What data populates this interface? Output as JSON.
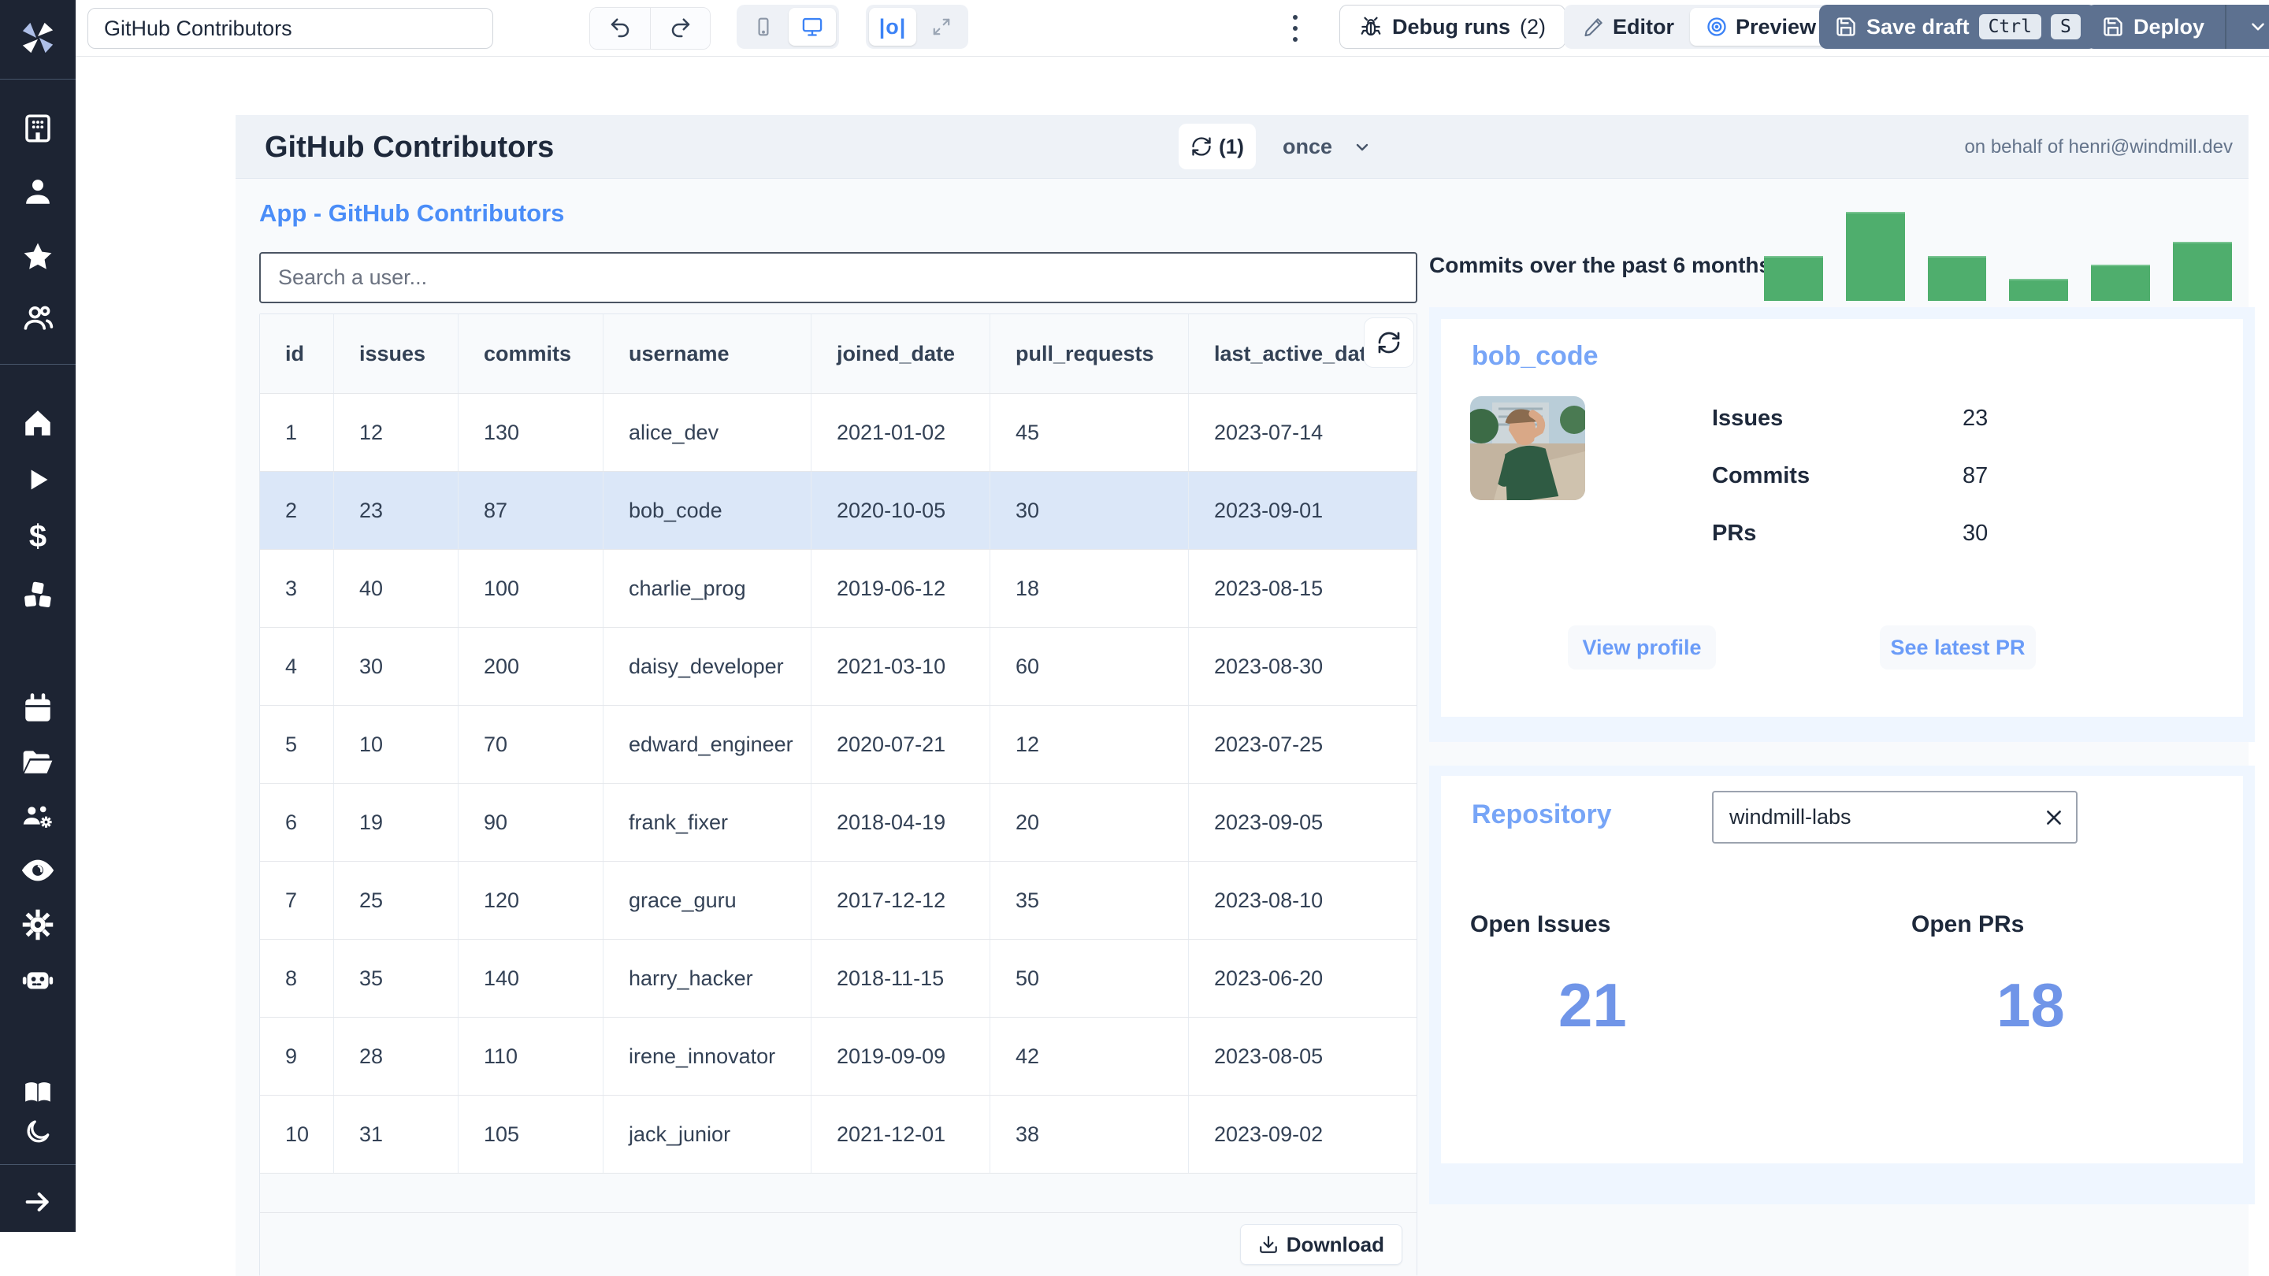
{
  "toolbar": {
    "app_title_input": "GitHub Contributors",
    "debug_runs_label": "Debug runs",
    "debug_runs_count": "(2)",
    "editor_label": "Editor",
    "preview_label": "Preview",
    "save_draft_label": "Save draft",
    "kbd_ctrl": "Ctrl",
    "kbd_s": "S",
    "deploy_label": "Deploy"
  },
  "sidebar": {
    "icons": [
      "windmill-logo",
      "building",
      "user",
      "star",
      "people",
      "home",
      "play",
      "dollar",
      "cubes",
      "calendar",
      "folder",
      "people-gear",
      "eye",
      "gear",
      "robot",
      "book",
      "moon",
      "arrow-right"
    ]
  },
  "header": {
    "title": "GitHub Contributors",
    "refresh_count": "(1)",
    "schedule_label": "once",
    "on_behalf": "on behalf of henri@windmill.dev"
  },
  "main": {
    "app_heading": "App - GitHub Contributors",
    "search_placeholder": "Search a user...",
    "table": {
      "columns": [
        "id",
        "issues",
        "commits",
        "username",
        "joined_date",
        "pull_requests",
        "last_active_date"
      ],
      "rows": [
        [
          "1",
          "12",
          "130",
          "alice_dev",
          "2021-01-02",
          "45",
          "2023-07-14"
        ],
        [
          "2",
          "23",
          "87",
          "bob_code",
          "2020-10-05",
          "30",
          "2023-09-01"
        ],
        [
          "3",
          "40",
          "100",
          "charlie_prog",
          "2019-06-12",
          "18",
          "2023-08-15"
        ],
        [
          "4",
          "30",
          "200",
          "daisy_developer",
          "2021-03-10",
          "60",
          "2023-08-30"
        ],
        [
          "5",
          "10",
          "70",
          "edward_engineer",
          "2020-07-21",
          "12",
          "2023-07-25"
        ],
        [
          "6",
          "19",
          "90",
          "frank_fixer",
          "2018-04-19",
          "20",
          "2023-09-05"
        ],
        [
          "7",
          "25",
          "120",
          "grace_guru",
          "2017-12-12",
          "35",
          "2023-08-10"
        ],
        [
          "8",
          "35",
          "140",
          "harry_hacker",
          "2018-11-15",
          "50",
          "2023-06-20"
        ],
        [
          "9",
          "28",
          "110",
          "irene_innovator",
          "2019-09-09",
          "42",
          "2023-08-05"
        ],
        [
          "10",
          "31",
          "105",
          "jack_junior",
          "2021-12-01",
          "38",
          "2023-09-02"
        ]
      ],
      "selected_row_index": 1,
      "download_label": "Download"
    }
  },
  "right_panel": {
    "chart": {
      "type": "bar",
      "label": "Commits over the past 6 months:",
      "bar_color": "#4fae6d",
      "values_pct": [
        50,
        100,
        50,
        25,
        41,
        66
      ]
    },
    "user_card": {
      "username": "bob_code",
      "stats": [
        {
          "label": "Issues",
          "value": "23"
        },
        {
          "label": "Commits",
          "value": "87"
        },
        {
          "label": "PRs",
          "value": "30"
        }
      ],
      "view_profile_label": "View profile",
      "see_latest_pr_label": "See latest PR"
    },
    "repository": {
      "heading": "Repository",
      "input_value": "windmill-labs",
      "open_issues_label": "Open Issues",
      "open_prs_label": "Open PRs",
      "open_issues_value": "21",
      "open_prs_value": "18"
    }
  },
  "colors": {
    "accent_blue": "#3b82f6",
    "soft_blue_heading": "#77a5f7",
    "big_number_blue": "#7095e8",
    "bar_green": "#4fae6d",
    "slate_button": "#5d7190",
    "row_highlight": "#dbe7f8",
    "panel_light_blue": "#eff6ff",
    "sidebar_dark": "#1d2433"
  }
}
